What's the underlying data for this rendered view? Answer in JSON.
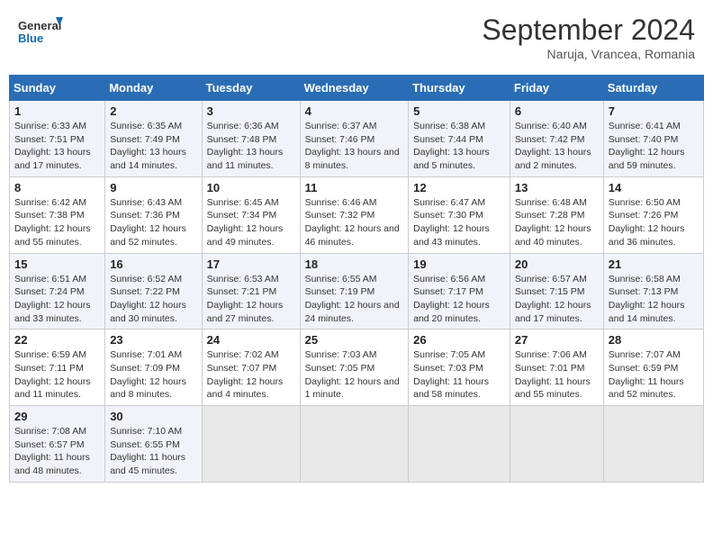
{
  "header": {
    "logo_line1": "General",
    "logo_line2": "Blue",
    "month": "September 2024",
    "location": "Naruja, Vrancea, Romania"
  },
  "columns": [
    "Sunday",
    "Monday",
    "Tuesday",
    "Wednesday",
    "Thursday",
    "Friday",
    "Saturday"
  ],
  "weeks": [
    [
      {
        "num": "1",
        "sunrise": "6:33 AM",
        "sunset": "7:51 PM",
        "daylight": "13 hours and 17 minutes."
      },
      {
        "num": "2",
        "sunrise": "6:35 AM",
        "sunset": "7:49 PM",
        "daylight": "13 hours and 14 minutes."
      },
      {
        "num": "3",
        "sunrise": "6:36 AM",
        "sunset": "7:48 PM",
        "daylight": "13 hours and 11 minutes."
      },
      {
        "num": "4",
        "sunrise": "6:37 AM",
        "sunset": "7:46 PM",
        "daylight": "13 hours and 8 minutes."
      },
      {
        "num": "5",
        "sunrise": "6:38 AM",
        "sunset": "7:44 PM",
        "daylight": "13 hours and 5 minutes."
      },
      {
        "num": "6",
        "sunrise": "6:40 AM",
        "sunset": "7:42 PM",
        "daylight": "13 hours and 2 minutes."
      },
      {
        "num": "7",
        "sunrise": "6:41 AM",
        "sunset": "7:40 PM",
        "daylight": "12 hours and 59 minutes."
      }
    ],
    [
      {
        "num": "8",
        "sunrise": "6:42 AM",
        "sunset": "7:38 PM",
        "daylight": "12 hours and 55 minutes."
      },
      {
        "num": "9",
        "sunrise": "6:43 AM",
        "sunset": "7:36 PM",
        "daylight": "12 hours and 52 minutes."
      },
      {
        "num": "10",
        "sunrise": "6:45 AM",
        "sunset": "7:34 PM",
        "daylight": "12 hours and 49 minutes."
      },
      {
        "num": "11",
        "sunrise": "6:46 AM",
        "sunset": "7:32 PM",
        "daylight": "12 hours and 46 minutes."
      },
      {
        "num": "12",
        "sunrise": "6:47 AM",
        "sunset": "7:30 PM",
        "daylight": "12 hours and 43 minutes."
      },
      {
        "num": "13",
        "sunrise": "6:48 AM",
        "sunset": "7:28 PM",
        "daylight": "12 hours and 40 minutes."
      },
      {
        "num": "14",
        "sunrise": "6:50 AM",
        "sunset": "7:26 PM",
        "daylight": "12 hours and 36 minutes."
      }
    ],
    [
      {
        "num": "15",
        "sunrise": "6:51 AM",
        "sunset": "7:24 PM",
        "daylight": "12 hours and 33 minutes."
      },
      {
        "num": "16",
        "sunrise": "6:52 AM",
        "sunset": "7:22 PM",
        "daylight": "12 hours and 30 minutes."
      },
      {
        "num": "17",
        "sunrise": "6:53 AM",
        "sunset": "7:21 PM",
        "daylight": "12 hours and 27 minutes."
      },
      {
        "num": "18",
        "sunrise": "6:55 AM",
        "sunset": "7:19 PM",
        "daylight": "12 hours and 24 minutes."
      },
      {
        "num": "19",
        "sunrise": "6:56 AM",
        "sunset": "7:17 PM",
        "daylight": "12 hours and 20 minutes."
      },
      {
        "num": "20",
        "sunrise": "6:57 AM",
        "sunset": "7:15 PM",
        "daylight": "12 hours and 17 minutes."
      },
      {
        "num": "21",
        "sunrise": "6:58 AM",
        "sunset": "7:13 PM",
        "daylight": "12 hours and 14 minutes."
      }
    ],
    [
      {
        "num": "22",
        "sunrise": "6:59 AM",
        "sunset": "7:11 PM",
        "daylight": "12 hours and 11 minutes."
      },
      {
        "num": "23",
        "sunrise": "7:01 AM",
        "sunset": "7:09 PM",
        "daylight": "12 hours and 8 minutes."
      },
      {
        "num": "24",
        "sunrise": "7:02 AM",
        "sunset": "7:07 PM",
        "daylight": "12 hours and 4 minutes."
      },
      {
        "num": "25",
        "sunrise": "7:03 AM",
        "sunset": "7:05 PM",
        "daylight": "12 hours and 1 minute."
      },
      {
        "num": "26",
        "sunrise": "7:05 AM",
        "sunset": "7:03 PM",
        "daylight": "11 hours and 58 minutes."
      },
      {
        "num": "27",
        "sunrise": "7:06 AM",
        "sunset": "7:01 PM",
        "daylight": "11 hours and 55 minutes."
      },
      {
        "num": "28",
        "sunrise": "7:07 AM",
        "sunset": "6:59 PM",
        "daylight": "11 hours and 52 minutes."
      }
    ],
    [
      {
        "num": "29",
        "sunrise": "7:08 AM",
        "sunset": "6:57 PM",
        "daylight": "11 hours and 48 minutes."
      },
      {
        "num": "30",
        "sunrise": "7:10 AM",
        "sunset": "6:55 PM",
        "daylight": "11 hours and 45 minutes."
      },
      null,
      null,
      null,
      null,
      null
    ]
  ]
}
